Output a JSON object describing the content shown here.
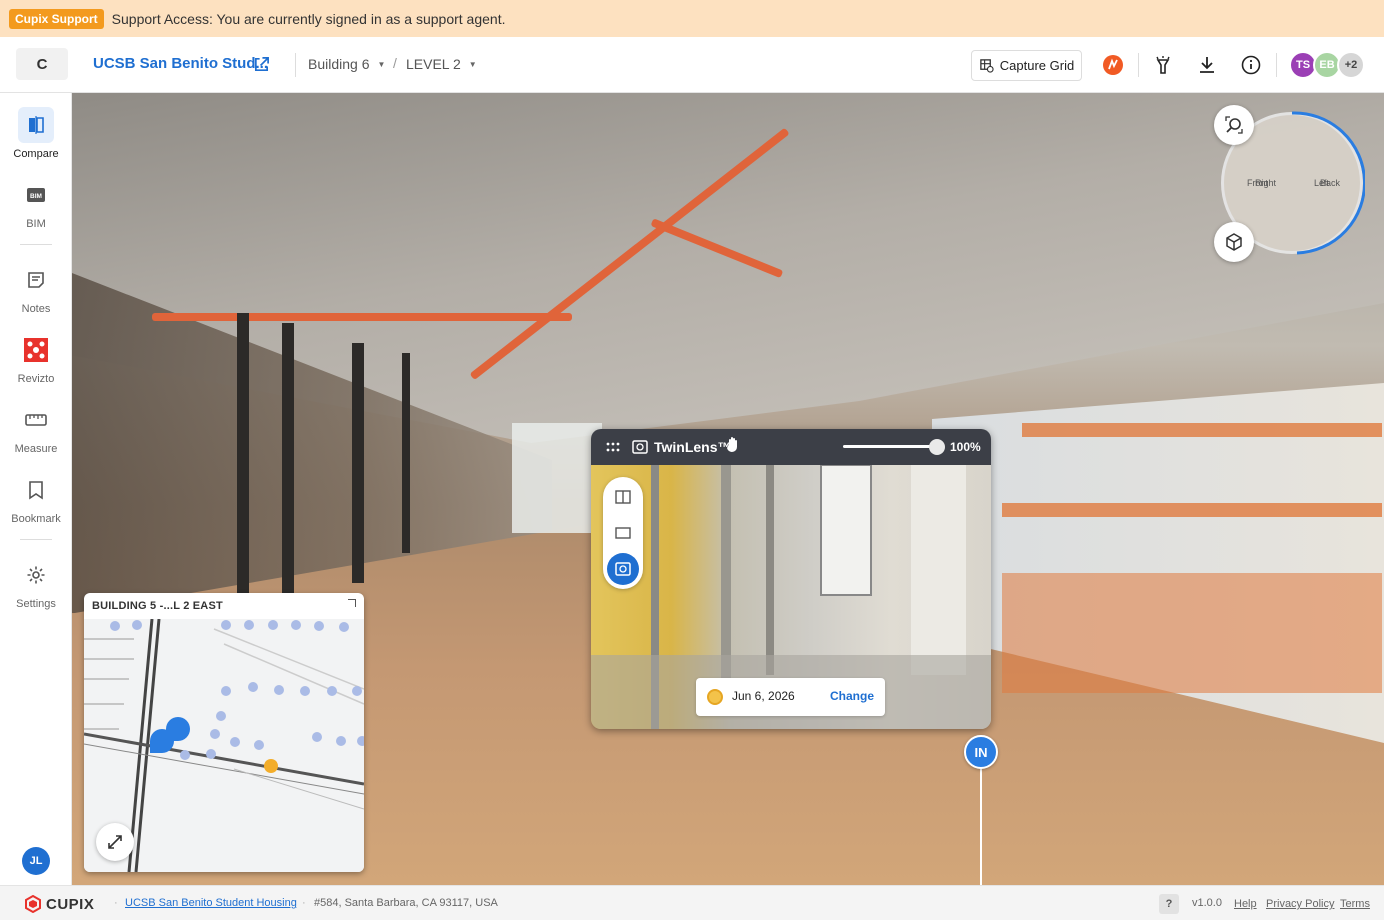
{
  "banner": {
    "tag": "Cupix Support",
    "message": "Support Access: You are currently signed in as a support agent."
  },
  "header": {
    "workspace_initial": "C",
    "project_title": "UCSB San Benito Stud...",
    "building": "Building 6",
    "level": "LEVEL 2",
    "capture_grid_label": "Capture Grid",
    "avatars": [
      {
        "initials": "TS",
        "color": "#9b3fb5"
      },
      {
        "initials": "EB",
        "color": "#a8d5a2"
      },
      {
        "initials": "+2",
        "color": "#cfcfcf"
      }
    ]
  },
  "sidebar": {
    "items": [
      {
        "label": "Compare",
        "icon": "compare-icon"
      },
      {
        "label": "BIM",
        "icon": "bim-icon"
      },
      {
        "label": "Notes",
        "icon": "notes-icon"
      },
      {
        "label": "Revizto",
        "icon": "revizto-icon"
      },
      {
        "label": "Measure",
        "icon": "ruler-icon"
      },
      {
        "label": "Bookmark",
        "icon": "bookmark-icon"
      },
      {
        "label": "Settings",
        "icon": "gear-icon"
      }
    ],
    "user_initials": "JL"
  },
  "compass": {
    "front_label": "Front",
    "right_label": "Right",
    "left_label": "Left",
    "back_label": "Back"
  },
  "minimap": {
    "title": "BUILDING 5 -...L 2 EAST"
  },
  "twinlens": {
    "title": "TwinLens™",
    "zoom": "100%",
    "zoom_fraction": 1.0,
    "date": "Jun 6, 2026",
    "change_label": "Change"
  },
  "marker": {
    "label": "IN"
  },
  "footer": {
    "brand": "CUPIX",
    "project_link": "UCSB San Benito Student Housing",
    "address": "#584, Santa Barbara, CA 93117, USA",
    "help_symbol": "?",
    "version": "v1.0.0",
    "links": [
      "Help",
      "Privacy Policy",
      "Terms"
    ]
  },
  "colors": {
    "accent": "#1f6fd1",
    "banner_bg": "#fde1c0",
    "banner_tag": "#f39a1e",
    "pipe": "#e0643a"
  }
}
